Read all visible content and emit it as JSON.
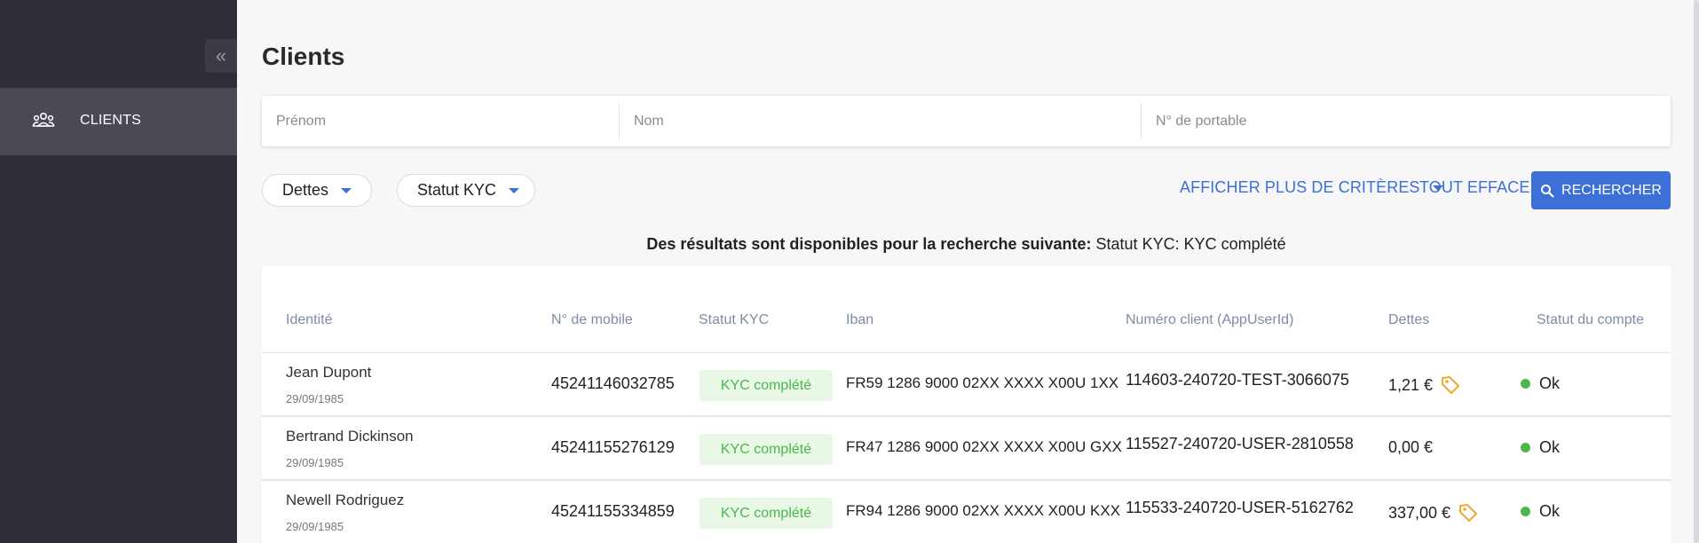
{
  "sidebar": {
    "collapse_icon": "chevrons-left-icon",
    "items": [
      {
        "label": "CLIENTS",
        "icon": "users-group-icon"
      }
    ]
  },
  "page": {
    "title": "Clients"
  },
  "search": {
    "first_name_placeholder": "Prénom",
    "last_name_placeholder": "Nom",
    "phone_placeholder": "N° de portable"
  },
  "filters": {
    "debts_label": "Dettes",
    "kyc_label": "Statut KYC"
  },
  "actions": {
    "more_criteria_label": "AFFICHER PLUS DE CRITÈRES",
    "clear_label": "TOUT EFFACER",
    "search_label": "RECHERCHER"
  },
  "result": {
    "prefix": "Des résultats sont disponibles pour la recherche suivante:",
    "criteria": "Statut KYC: KYC complété"
  },
  "table": {
    "headers": [
      "Identité",
      "N° de mobile",
      "Statut KYC",
      "Iban",
      "Numéro client (AppUserId)",
      "Dettes",
      "Statut du compte"
    ],
    "rows": [
      {
        "name": "Jean Dupont",
        "dob": "29/09/1985",
        "mobile": "45241146032785",
        "kyc": "KYC complété",
        "iban": "FR59 1286 9000 02XX XXXX X00U 1XX",
        "client_id": "114603-240720-TEST-3066075",
        "debts": "1,21 €",
        "has_tag": true,
        "status": "Ok"
      },
      {
        "name": "Bertrand Dickinson",
        "dob": "29/09/1985",
        "mobile": "45241155276129",
        "kyc": "KYC complété",
        "iban": "FR47 1286 9000 02XX XXXX X00U GXX",
        "client_id": "115527-240720-USER-2810558",
        "debts": "0,00 €",
        "has_tag": false,
        "status": "Ok"
      },
      {
        "name": "Newell Rodriguez",
        "dob": "29/09/1985",
        "mobile": "45241155334859",
        "kyc": "KYC complété",
        "iban": "FR94 1286 9000 02XX XXXX X00U KXX",
        "client_id": "115533-240720-USER-5162762",
        "debts": "337,00 €",
        "has_tag": true,
        "status": "Ok"
      }
    ]
  },
  "colors": {
    "sidebar_bg": "#2e2e38",
    "sidebar_active": "#4a4a55",
    "accent": "#3c6fd8",
    "success": "#4cb84b",
    "tag": "#f0a830"
  }
}
